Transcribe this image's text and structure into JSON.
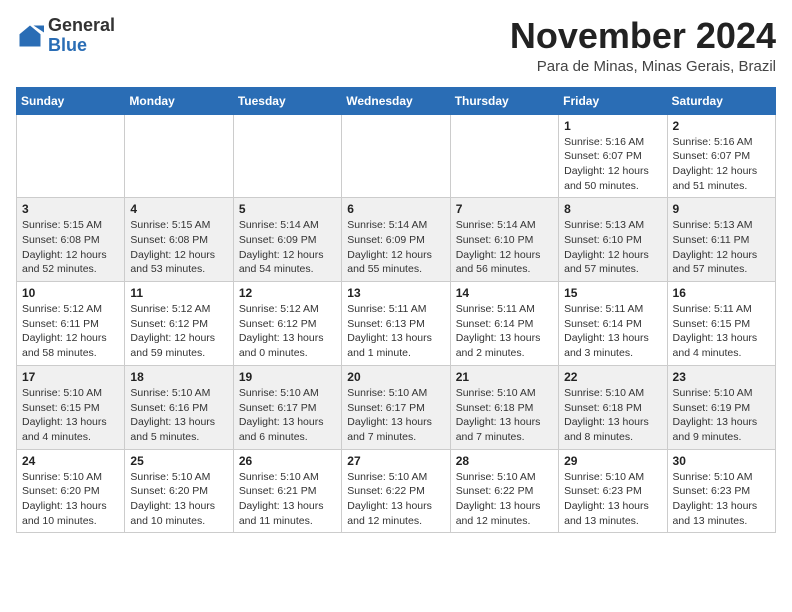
{
  "header": {
    "logo_general": "General",
    "logo_blue": "Blue",
    "month_title": "November 2024",
    "location": "Para de Minas, Minas Gerais, Brazil"
  },
  "weekdays": [
    "Sunday",
    "Monday",
    "Tuesday",
    "Wednesday",
    "Thursday",
    "Friday",
    "Saturday"
  ],
  "weeks": [
    [
      {
        "day": "",
        "info": ""
      },
      {
        "day": "",
        "info": ""
      },
      {
        "day": "",
        "info": ""
      },
      {
        "day": "",
        "info": ""
      },
      {
        "day": "",
        "info": ""
      },
      {
        "day": "1",
        "info": "Sunrise: 5:16 AM\nSunset: 6:07 PM\nDaylight: 12 hours\nand 50 minutes."
      },
      {
        "day": "2",
        "info": "Sunrise: 5:16 AM\nSunset: 6:07 PM\nDaylight: 12 hours\nand 51 minutes."
      }
    ],
    [
      {
        "day": "3",
        "info": "Sunrise: 5:15 AM\nSunset: 6:08 PM\nDaylight: 12 hours\nand 52 minutes."
      },
      {
        "day": "4",
        "info": "Sunrise: 5:15 AM\nSunset: 6:08 PM\nDaylight: 12 hours\nand 53 minutes."
      },
      {
        "day": "5",
        "info": "Sunrise: 5:14 AM\nSunset: 6:09 PM\nDaylight: 12 hours\nand 54 minutes."
      },
      {
        "day": "6",
        "info": "Sunrise: 5:14 AM\nSunset: 6:09 PM\nDaylight: 12 hours\nand 55 minutes."
      },
      {
        "day": "7",
        "info": "Sunrise: 5:14 AM\nSunset: 6:10 PM\nDaylight: 12 hours\nand 56 minutes."
      },
      {
        "day": "8",
        "info": "Sunrise: 5:13 AM\nSunset: 6:10 PM\nDaylight: 12 hours\nand 57 minutes."
      },
      {
        "day": "9",
        "info": "Sunrise: 5:13 AM\nSunset: 6:11 PM\nDaylight: 12 hours\nand 57 minutes."
      }
    ],
    [
      {
        "day": "10",
        "info": "Sunrise: 5:12 AM\nSunset: 6:11 PM\nDaylight: 12 hours\nand 58 minutes."
      },
      {
        "day": "11",
        "info": "Sunrise: 5:12 AM\nSunset: 6:12 PM\nDaylight: 12 hours\nand 59 minutes."
      },
      {
        "day": "12",
        "info": "Sunrise: 5:12 AM\nSunset: 6:12 PM\nDaylight: 13 hours\nand 0 minutes."
      },
      {
        "day": "13",
        "info": "Sunrise: 5:11 AM\nSunset: 6:13 PM\nDaylight: 13 hours\nand 1 minute."
      },
      {
        "day": "14",
        "info": "Sunrise: 5:11 AM\nSunset: 6:14 PM\nDaylight: 13 hours\nand 2 minutes."
      },
      {
        "day": "15",
        "info": "Sunrise: 5:11 AM\nSunset: 6:14 PM\nDaylight: 13 hours\nand 3 minutes."
      },
      {
        "day": "16",
        "info": "Sunrise: 5:11 AM\nSunset: 6:15 PM\nDaylight: 13 hours\nand 4 minutes."
      }
    ],
    [
      {
        "day": "17",
        "info": "Sunrise: 5:10 AM\nSunset: 6:15 PM\nDaylight: 13 hours\nand 4 minutes."
      },
      {
        "day": "18",
        "info": "Sunrise: 5:10 AM\nSunset: 6:16 PM\nDaylight: 13 hours\nand 5 minutes."
      },
      {
        "day": "19",
        "info": "Sunrise: 5:10 AM\nSunset: 6:17 PM\nDaylight: 13 hours\nand 6 minutes."
      },
      {
        "day": "20",
        "info": "Sunrise: 5:10 AM\nSunset: 6:17 PM\nDaylight: 13 hours\nand 7 minutes."
      },
      {
        "day": "21",
        "info": "Sunrise: 5:10 AM\nSunset: 6:18 PM\nDaylight: 13 hours\nand 7 minutes."
      },
      {
        "day": "22",
        "info": "Sunrise: 5:10 AM\nSunset: 6:18 PM\nDaylight: 13 hours\nand 8 minutes."
      },
      {
        "day": "23",
        "info": "Sunrise: 5:10 AM\nSunset: 6:19 PM\nDaylight: 13 hours\nand 9 minutes."
      }
    ],
    [
      {
        "day": "24",
        "info": "Sunrise: 5:10 AM\nSunset: 6:20 PM\nDaylight: 13 hours\nand 10 minutes."
      },
      {
        "day": "25",
        "info": "Sunrise: 5:10 AM\nSunset: 6:20 PM\nDaylight: 13 hours\nand 10 minutes."
      },
      {
        "day": "26",
        "info": "Sunrise: 5:10 AM\nSunset: 6:21 PM\nDaylight: 13 hours\nand 11 minutes."
      },
      {
        "day": "27",
        "info": "Sunrise: 5:10 AM\nSunset: 6:22 PM\nDaylight: 13 hours\nand 12 minutes."
      },
      {
        "day": "28",
        "info": "Sunrise: 5:10 AM\nSunset: 6:22 PM\nDaylight: 13 hours\nand 12 minutes."
      },
      {
        "day": "29",
        "info": "Sunrise: 5:10 AM\nSunset: 6:23 PM\nDaylight: 13 hours\nand 13 minutes."
      },
      {
        "day": "30",
        "info": "Sunrise: 5:10 AM\nSunset: 6:23 PM\nDaylight: 13 hours\nand 13 minutes."
      }
    ]
  ]
}
